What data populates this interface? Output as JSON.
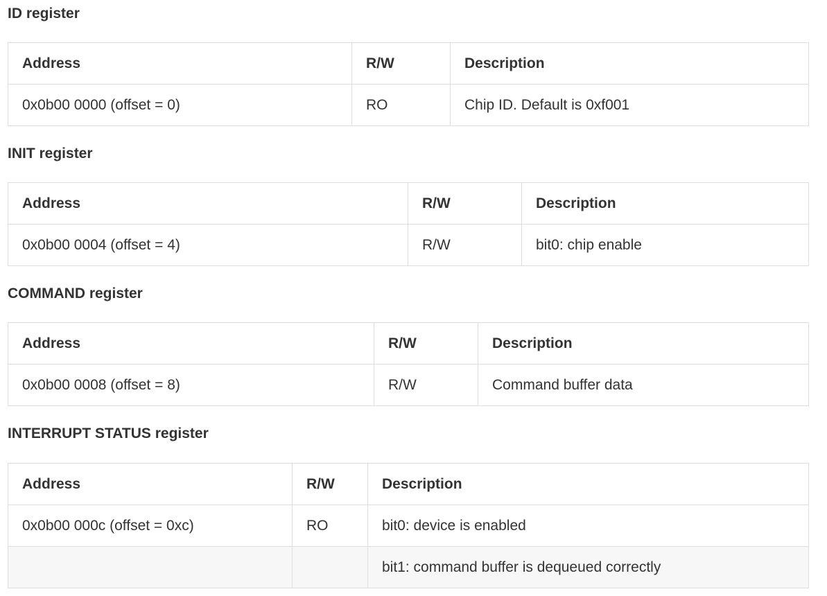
{
  "columns": {
    "address": "Address",
    "rw": "R/W",
    "description": "Description"
  },
  "registers": [
    {
      "title": "ID register",
      "rows": [
        {
          "address": "0x0b00 0000 (offset = 0)",
          "rw": "RO",
          "description": "Chip ID. Default is 0xf001"
        }
      ]
    },
    {
      "title": "INIT register",
      "rows": [
        {
          "address": "0x0b00 0004 (offset = 4)",
          "rw": "R/W",
          "description": "bit0: chip enable"
        }
      ]
    },
    {
      "title": "COMMAND register",
      "rows": [
        {
          "address": "0x0b00 0008 (offset = 8)",
          "rw": "R/W",
          "description": "Command buffer data"
        }
      ]
    },
    {
      "title": "INTERRUPT STATUS register",
      "rows": [
        {
          "address": "0x0b00 000c (offset = 0xc)",
          "rw": "RO",
          "description": "bit0: device is enabled"
        },
        {
          "address": "",
          "rw": "",
          "description": "bit1: command buffer is dequeued correctly"
        }
      ]
    }
  ]
}
